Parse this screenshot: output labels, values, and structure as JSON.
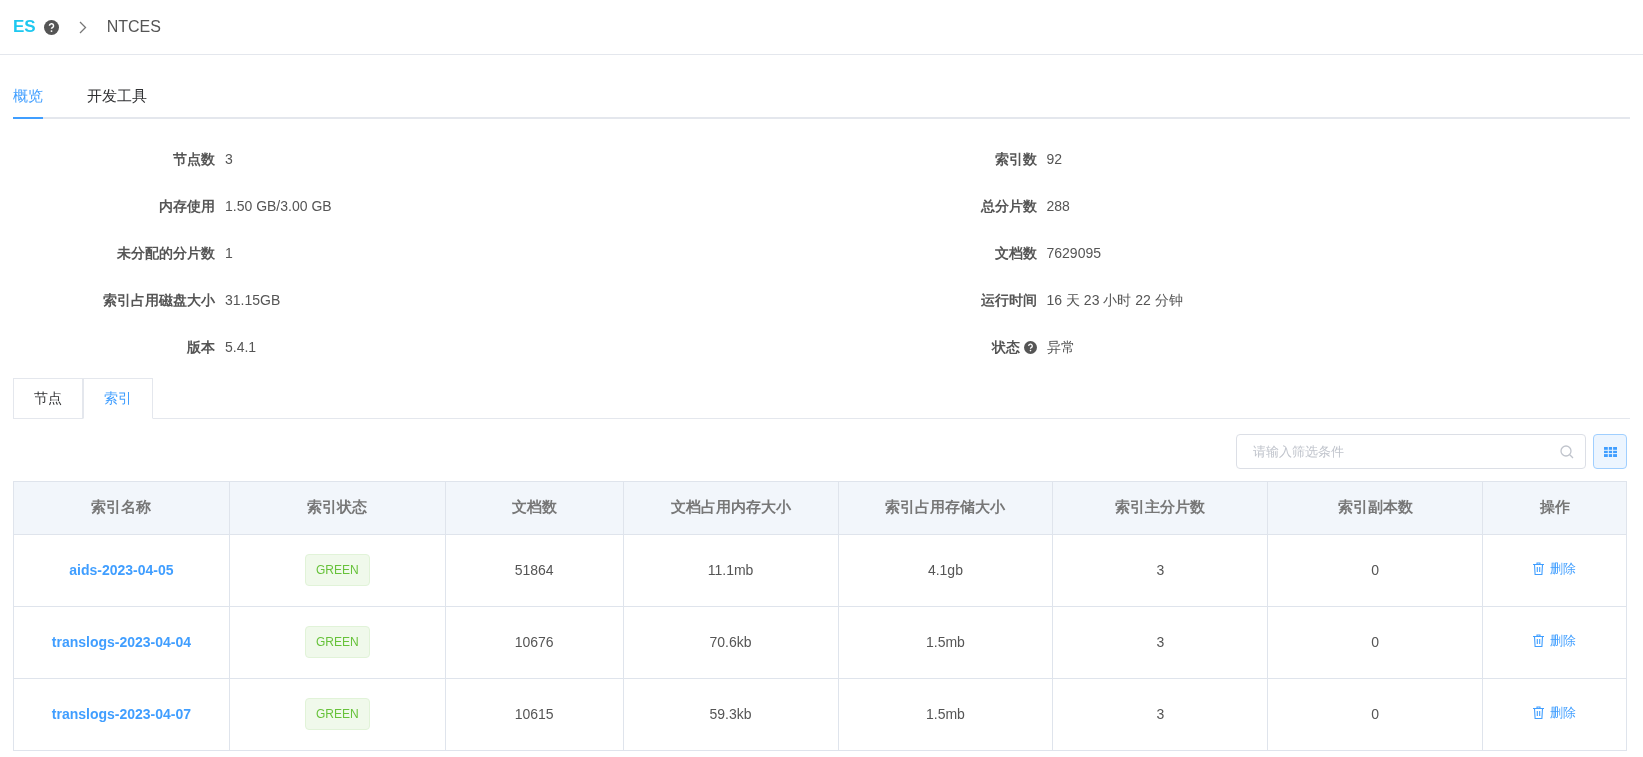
{
  "breadcrumb": {
    "logo": "ES",
    "current": "NTCES"
  },
  "tabs": [
    {
      "label": "概览",
      "selected": true
    },
    {
      "label": "开发工具",
      "selected": false
    }
  ],
  "stats": [
    {
      "label": "节点数",
      "value": "3"
    },
    {
      "label": "索引数",
      "value": "92"
    },
    {
      "label": "内存使用",
      "value": "1.50 GB/3.00 GB"
    },
    {
      "label": "总分片数",
      "value": "288"
    },
    {
      "label": "未分配的分片数",
      "value": "1"
    },
    {
      "label": "文档数",
      "value": "7629095"
    },
    {
      "label": "索引占用磁盘大小",
      "value": "31.15GB"
    },
    {
      "label": "运行时间",
      "value": "16 天 23 小时 22 分钟"
    },
    {
      "label": "版本",
      "value": "5.4.1"
    },
    {
      "label": "状态",
      "value": "异常",
      "help": true
    }
  ],
  "subtabs": [
    {
      "label": "节点",
      "selected": false
    },
    {
      "label": "索引",
      "selected": true
    }
  ],
  "search": {
    "placeholder": "请输入筛选条件"
  },
  "table": {
    "columns": [
      "索引名称",
      "索引状态",
      "文档数",
      "文档占用内存大小",
      "索引占用存储大小",
      "索引主分片数",
      "索引副本数",
      "操作"
    ],
    "rows": [
      {
        "name": "aids-2023-04-05",
        "status": "GREEN",
        "docs": "51864",
        "mem": "11.1mb",
        "store": "4.1gb",
        "primary": "3",
        "replica": "0",
        "action": "删除"
      },
      {
        "name": "translogs-2023-04-04",
        "status": "GREEN",
        "docs": "10676",
        "mem": "70.6kb",
        "store": "1.5mb",
        "primary": "3",
        "replica": "0",
        "action": "删除"
      },
      {
        "name": "translogs-2023-04-07",
        "status": "GREEN",
        "docs": "10615",
        "mem": "59.3kb",
        "store": "1.5mb",
        "primary": "3",
        "replica": "0",
        "action": "删除"
      }
    ]
  }
}
